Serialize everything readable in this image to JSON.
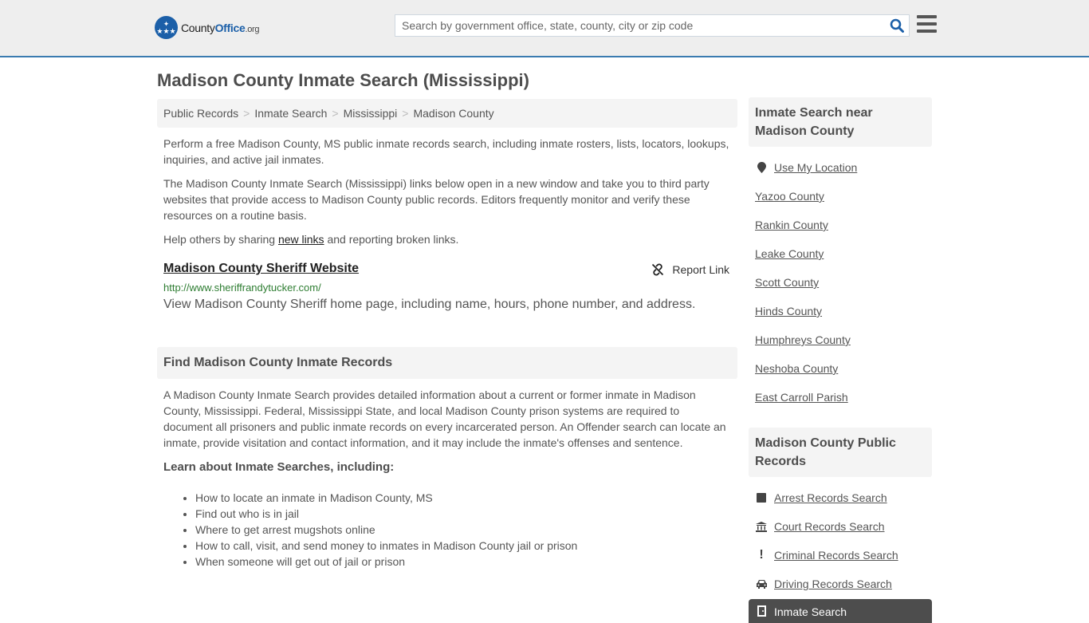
{
  "header": {
    "logo": {
      "name_main": "County",
      "name_accent": "Office",
      "name_suffix": ".org"
    },
    "search": {
      "placeholder": "Search by government office, state, county, city or zip code",
      "value": ""
    },
    "colors": {
      "accent": "#1b5fa8",
      "header_border": "#3a7bb0"
    }
  },
  "main": {
    "title": "Madison County Inmate Search (Mississippi)",
    "breadcrumb": [
      "Public Records",
      "Inmate Search",
      "Mississippi",
      "Madison County"
    ],
    "intro1": "Perform a free Madison County, MS public inmate records search, including inmate rosters, lists, locators, lookups, inquiries, and active jail inmates.",
    "intro2": "The Madison County Inmate Search (Mississippi) links below open in a new window and take you to third party websites that provide access to Madison County public records. Editors frequently monitor and verify these resources on a routine basis.",
    "help": {
      "before": "Help others by sharing ",
      "link": "new links",
      "after": " and reporting broken links."
    },
    "results": [
      {
        "title": "Madison County Sheriff Website",
        "url": "http://www.sheriffrandytucker.com/",
        "description": "View Madison County Sheriff home page, including name, hours, phone number, and address.",
        "report_label": "Report Link"
      }
    ],
    "section": {
      "heading": "Find Madison County Inmate Records",
      "body": "A Madison County Inmate Search provides detailed information about a current or former inmate in Madison County, Mississippi. Federal, Mississippi State, and local Madison County prison systems are required to document all prisoners and public inmate records on every incarcerated person. An Offender search can locate an inmate, provide visitation and contact information, and it may include the inmate's offenses and sentence.",
      "learn_heading": "Learn about Inmate Searches, including:",
      "topics": [
        "How to locate an inmate in Madison County, MS",
        "Find out who is in jail",
        "Where to get arrest mugshots online",
        "How to call, visit, and send money to inmates in Madison County jail or prison",
        "When someone will get out of jail or prison"
      ]
    }
  },
  "sidebar": {
    "nearby": {
      "heading": "Inmate Search near Madison County",
      "use_location": {
        "label": "Use My Location",
        "icon": "map-marker-icon"
      },
      "items": [
        "Yazoo County",
        "Rankin County",
        "Leake County",
        "Scott County",
        "Hinds County",
        "Humphreys County",
        "Neshoba County",
        "East Carroll Parish"
      ]
    },
    "records": {
      "heading": "Madison County Public Records",
      "items": [
        {
          "label": "Arrest Records Search",
          "icon": "square-icon"
        },
        {
          "label": "Court Records Search",
          "icon": "courthouse-icon"
        },
        {
          "label": "Criminal Records Search",
          "icon": "exclamation-icon"
        },
        {
          "label": "Driving Records Search",
          "icon": "car-icon"
        },
        {
          "label": "Inmate Search",
          "icon": "door-icon",
          "active": true
        }
      ]
    }
  }
}
